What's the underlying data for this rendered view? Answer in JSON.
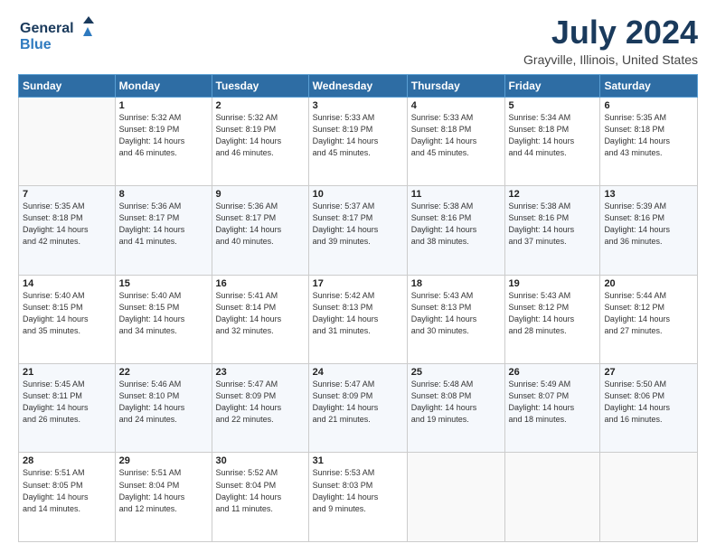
{
  "header": {
    "logo_general": "General",
    "logo_blue": "Blue",
    "title": "July 2024",
    "subtitle": "Grayville, Illinois, United States"
  },
  "weekdays": [
    "Sunday",
    "Monday",
    "Tuesday",
    "Wednesday",
    "Thursday",
    "Friday",
    "Saturday"
  ],
  "weeks": [
    [
      {
        "day": "",
        "sunrise": "",
        "sunset": "",
        "daylight": ""
      },
      {
        "day": "1",
        "sunrise": "Sunrise: 5:32 AM",
        "sunset": "Sunset: 8:19 PM",
        "daylight": "Daylight: 14 hours and 46 minutes."
      },
      {
        "day": "2",
        "sunrise": "Sunrise: 5:32 AM",
        "sunset": "Sunset: 8:19 PM",
        "daylight": "Daylight: 14 hours and 46 minutes."
      },
      {
        "day": "3",
        "sunrise": "Sunrise: 5:33 AM",
        "sunset": "Sunset: 8:19 PM",
        "daylight": "Daylight: 14 hours and 45 minutes."
      },
      {
        "day": "4",
        "sunrise": "Sunrise: 5:33 AM",
        "sunset": "Sunset: 8:18 PM",
        "daylight": "Daylight: 14 hours and 45 minutes."
      },
      {
        "day": "5",
        "sunrise": "Sunrise: 5:34 AM",
        "sunset": "Sunset: 8:18 PM",
        "daylight": "Daylight: 14 hours and 44 minutes."
      },
      {
        "day": "6",
        "sunrise": "Sunrise: 5:35 AM",
        "sunset": "Sunset: 8:18 PM",
        "daylight": "Daylight: 14 hours and 43 minutes."
      }
    ],
    [
      {
        "day": "7",
        "sunrise": "Sunrise: 5:35 AM",
        "sunset": "Sunset: 8:18 PM",
        "daylight": "Daylight: 14 hours and 42 minutes."
      },
      {
        "day": "8",
        "sunrise": "Sunrise: 5:36 AM",
        "sunset": "Sunset: 8:17 PM",
        "daylight": "Daylight: 14 hours and 41 minutes."
      },
      {
        "day": "9",
        "sunrise": "Sunrise: 5:36 AM",
        "sunset": "Sunset: 8:17 PM",
        "daylight": "Daylight: 14 hours and 40 minutes."
      },
      {
        "day": "10",
        "sunrise": "Sunrise: 5:37 AM",
        "sunset": "Sunset: 8:17 PM",
        "daylight": "Daylight: 14 hours and 39 minutes."
      },
      {
        "day": "11",
        "sunrise": "Sunrise: 5:38 AM",
        "sunset": "Sunset: 8:16 PM",
        "daylight": "Daylight: 14 hours and 38 minutes."
      },
      {
        "day": "12",
        "sunrise": "Sunrise: 5:38 AM",
        "sunset": "Sunset: 8:16 PM",
        "daylight": "Daylight: 14 hours and 37 minutes."
      },
      {
        "day": "13",
        "sunrise": "Sunrise: 5:39 AM",
        "sunset": "Sunset: 8:16 PM",
        "daylight": "Daylight: 14 hours and 36 minutes."
      }
    ],
    [
      {
        "day": "14",
        "sunrise": "Sunrise: 5:40 AM",
        "sunset": "Sunset: 8:15 PM",
        "daylight": "Daylight: 14 hours and 35 minutes."
      },
      {
        "day": "15",
        "sunrise": "Sunrise: 5:40 AM",
        "sunset": "Sunset: 8:15 PM",
        "daylight": "Daylight: 14 hours and 34 minutes."
      },
      {
        "day": "16",
        "sunrise": "Sunrise: 5:41 AM",
        "sunset": "Sunset: 8:14 PM",
        "daylight": "Daylight: 14 hours and 32 minutes."
      },
      {
        "day": "17",
        "sunrise": "Sunrise: 5:42 AM",
        "sunset": "Sunset: 8:13 PM",
        "daylight": "Daylight: 14 hours and 31 minutes."
      },
      {
        "day": "18",
        "sunrise": "Sunrise: 5:43 AM",
        "sunset": "Sunset: 8:13 PM",
        "daylight": "Daylight: 14 hours and 30 minutes."
      },
      {
        "day": "19",
        "sunrise": "Sunrise: 5:43 AM",
        "sunset": "Sunset: 8:12 PM",
        "daylight": "Daylight: 14 hours and 28 minutes."
      },
      {
        "day": "20",
        "sunrise": "Sunrise: 5:44 AM",
        "sunset": "Sunset: 8:12 PM",
        "daylight": "Daylight: 14 hours and 27 minutes."
      }
    ],
    [
      {
        "day": "21",
        "sunrise": "Sunrise: 5:45 AM",
        "sunset": "Sunset: 8:11 PM",
        "daylight": "Daylight: 14 hours and 26 minutes."
      },
      {
        "day": "22",
        "sunrise": "Sunrise: 5:46 AM",
        "sunset": "Sunset: 8:10 PM",
        "daylight": "Daylight: 14 hours and 24 minutes."
      },
      {
        "day": "23",
        "sunrise": "Sunrise: 5:47 AM",
        "sunset": "Sunset: 8:09 PM",
        "daylight": "Daylight: 14 hours and 22 minutes."
      },
      {
        "day": "24",
        "sunrise": "Sunrise: 5:47 AM",
        "sunset": "Sunset: 8:09 PM",
        "daylight": "Daylight: 14 hours and 21 minutes."
      },
      {
        "day": "25",
        "sunrise": "Sunrise: 5:48 AM",
        "sunset": "Sunset: 8:08 PM",
        "daylight": "Daylight: 14 hours and 19 minutes."
      },
      {
        "day": "26",
        "sunrise": "Sunrise: 5:49 AM",
        "sunset": "Sunset: 8:07 PM",
        "daylight": "Daylight: 14 hours and 18 minutes."
      },
      {
        "day": "27",
        "sunrise": "Sunrise: 5:50 AM",
        "sunset": "Sunset: 8:06 PM",
        "daylight": "Daylight: 14 hours and 16 minutes."
      }
    ],
    [
      {
        "day": "28",
        "sunrise": "Sunrise: 5:51 AM",
        "sunset": "Sunset: 8:05 PM",
        "daylight": "Daylight: 14 hours and 14 minutes."
      },
      {
        "day": "29",
        "sunrise": "Sunrise: 5:51 AM",
        "sunset": "Sunset: 8:04 PM",
        "daylight": "Daylight: 14 hours and 12 minutes."
      },
      {
        "day": "30",
        "sunrise": "Sunrise: 5:52 AM",
        "sunset": "Sunset: 8:04 PM",
        "daylight": "Daylight: 14 hours and 11 minutes."
      },
      {
        "day": "31",
        "sunrise": "Sunrise: 5:53 AM",
        "sunset": "Sunset: 8:03 PM",
        "daylight": "Daylight: 14 hours and 9 minutes."
      },
      {
        "day": "",
        "sunrise": "",
        "sunset": "",
        "daylight": ""
      },
      {
        "day": "",
        "sunrise": "",
        "sunset": "",
        "daylight": ""
      },
      {
        "day": "",
        "sunrise": "",
        "sunset": "",
        "daylight": ""
      }
    ]
  ]
}
